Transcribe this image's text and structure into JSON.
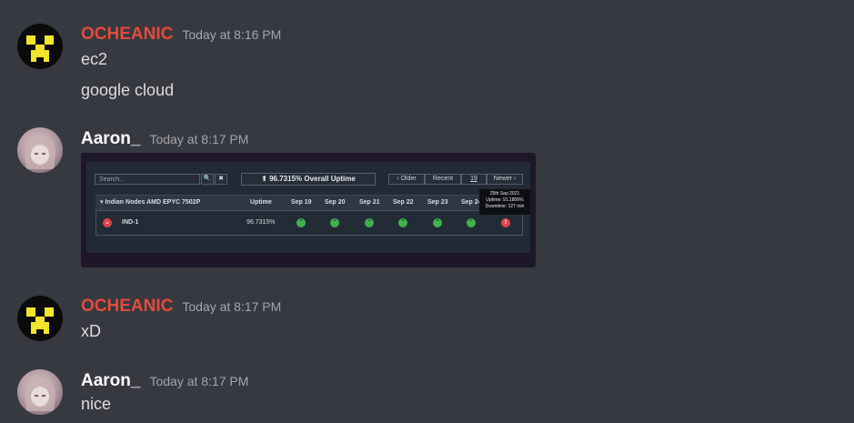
{
  "messages": [
    {
      "author": "OCHEANIC",
      "timestamp": "Today at 8:16 PM",
      "lines": [
        "ec2",
        "google cloud"
      ]
    },
    {
      "author": "Aaron_",
      "timestamp": "Today at 8:17 PM"
    },
    {
      "author": "OCHEANIC",
      "timestamp": "Today at 8:17 PM",
      "lines": [
        "xD"
      ]
    },
    {
      "author": "Aaron_",
      "timestamp": "Today at 8:17 PM",
      "lines": [
        "nice"
      ]
    }
  ],
  "embed": {
    "search_placeholder": "Search...",
    "search_icon": "🔍",
    "clear_icon": "✖",
    "overall_uptime": "96.7315% Overall Uptime",
    "nav": {
      "older": "‹ Older",
      "recent": "Recent",
      "calendar_day": "19",
      "newer": "Newer ›"
    },
    "table": {
      "group": "Indian Nodes AMD EPYC 7502P",
      "columns": [
        "Uptime",
        "Sep 19",
        "Sep 20",
        "Sep 21",
        "Sep 22",
        "Sep 23",
        "Sep 24"
      ],
      "row": {
        "name": "IND-1",
        "uptime": "96.7315%"
      }
    },
    "tooltip": {
      "date": "25th Sep 2021",
      "uptime": "Uptime: 91.1806%",
      "downtime": "Downtime: 127 min"
    },
    "colors": {
      "up": "#3fb24f",
      "down": "#e2434b"
    }
  },
  "colors": {
    "ocheanic_name": "#e54b3c",
    "aaron_name": "#ffffff",
    "background": "#36393f"
  }
}
